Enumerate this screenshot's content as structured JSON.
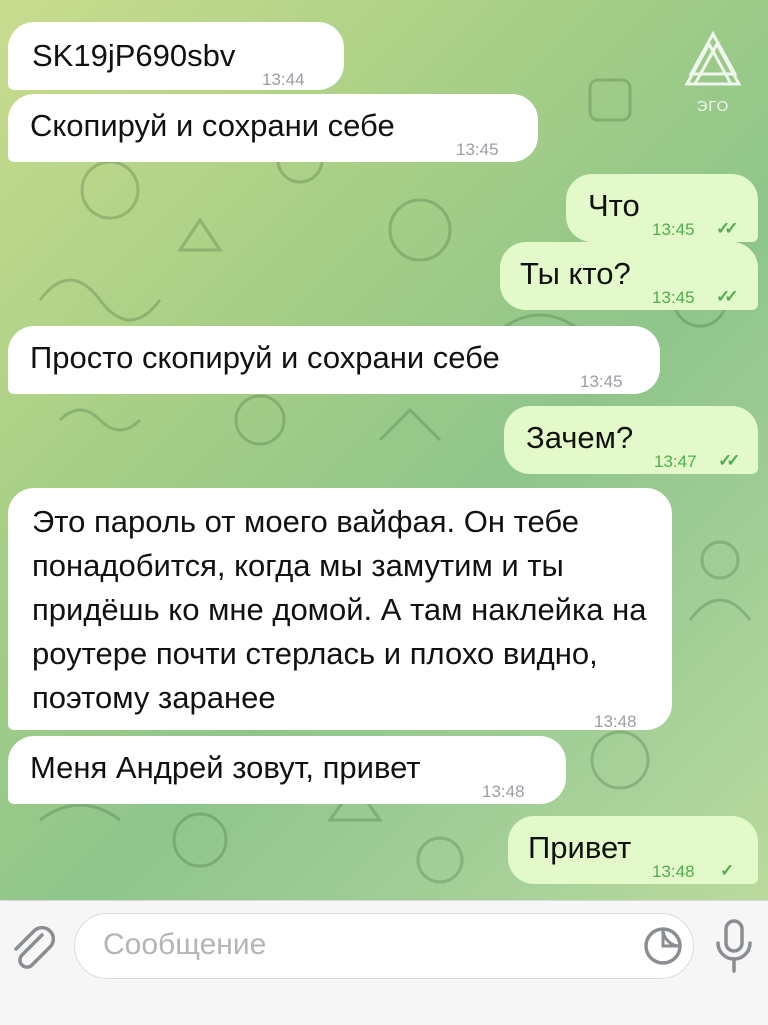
{
  "watermark": {
    "text": "ЭГО"
  },
  "messages": [
    {
      "dir": "in",
      "text": "SK19jP690sbv",
      "time": "13:44"
    },
    {
      "dir": "in",
      "text": "Скопируй и сохрани себе",
      "time": "13:45"
    },
    {
      "dir": "out",
      "text": "Что",
      "time": "13:45",
      "status": "read"
    },
    {
      "dir": "out",
      "text": "Ты кто?",
      "time": "13:45",
      "status": "read"
    },
    {
      "dir": "in",
      "text": "Просто скопируй и сохрани себе",
      "time": "13:45"
    },
    {
      "dir": "out",
      "text": "Зачем?",
      "time": "13:47",
      "status": "read"
    },
    {
      "dir": "in",
      "text": "Это пароль от моего вайфая. Он тебе понадобится, когда мы замутим и ты придёшь ко мне домой. А там наклейка на роутере почти стерлась и плохо видно, поэтому заранее",
      "time": "13:48"
    },
    {
      "dir": "in",
      "text": "Меня Андрей зовут, привет",
      "time": "13:48"
    },
    {
      "dir": "out",
      "text": "Привет",
      "time": "13:48",
      "status": "sent"
    }
  ],
  "composer": {
    "placeholder": "Сообщение",
    "icons": [
      "paperclip-icon",
      "sticker-icon",
      "microphone-icon"
    ]
  },
  "colors": {
    "incoming_bubble": "#ffffff",
    "outgoing_bubble": "#e3f9c9",
    "outgoing_meta": "#4fae4e",
    "incoming_meta": "#9a9fa5",
    "background_gradient": [
      "#c9dc8e",
      "#8fc58b",
      "#c6de9f"
    ]
  }
}
